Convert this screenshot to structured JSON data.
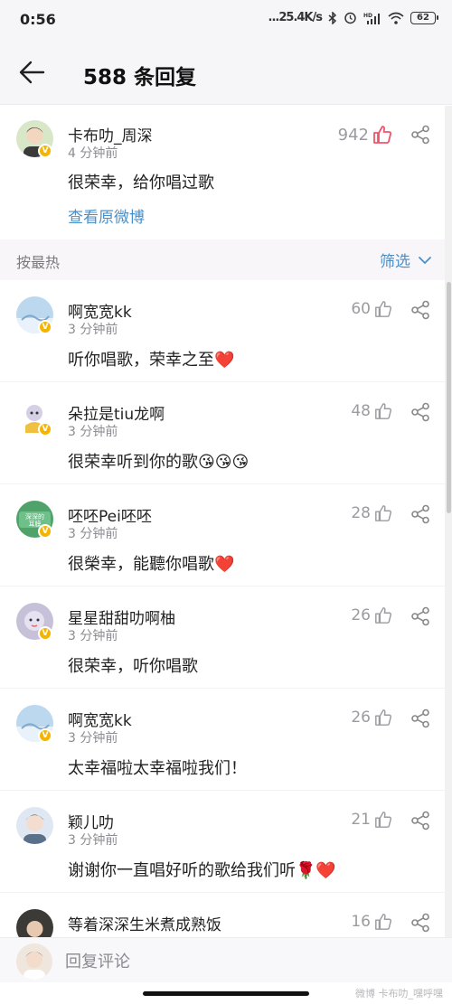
{
  "status_bar": {
    "time": "0:56",
    "network_speed": "...25.4K/s",
    "battery": "62",
    "icons": [
      "bluetooth-icon",
      "alarm-icon",
      "hd-signal-icon",
      "wifi-icon",
      "battery-icon"
    ]
  },
  "header": {
    "title": "588 条回复",
    "back_icon": "arrow-left-icon"
  },
  "original_post": {
    "author": "卡布叻_周深",
    "time": "4 分钟前",
    "text": "很荣幸，给你唱过歌",
    "likes": "942",
    "link": "查看原微博",
    "liked": true
  },
  "sort_bar": {
    "label": "按最热",
    "filter": "筛选"
  },
  "comments": [
    {
      "author": "啊宽宽kk",
      "time": "3 分钟前",
      "text": "听你唱歌，荣幸之至❤️",
      "likes": "60"
    },
    {
      "author": "朵拉是tiu龙啊",
      "time": "3 分钟前",
      "text": "很荣幸听到你的歌😘😘😘",
      "likes": "48"
    },
    {
      "author": "呸呸Pei呸呸",
      "time": "3 分钟前",
      "text": "很榮幸，能聽你唱歌❤️",
      "likes": "28"
    },
    {
      "author": "星星甜甜叻啊柚",
      "time": "3 分钟前",
      "text": "很荣幸，听你唱歌",
      "likes": "26"
    },
    {
      "author": "啊宽宽kk",
      "time": "3 分钟前",
      "text": "太幸福啦太幸福啦我们！",
      "likes": "26"
    },
    {
      "author": "颖儿叻",
      "time": "3 分钟前",
      "text": "谢谢你一直唱好听的歌给我们听🌹❤️",
      "likes": "21"
    },
    {
      "author": "等着深深生米煮成熟饭",
      "time": "",
      "text": "",
      "likes": "16"
    }
  ],
  "reply_bar": {
    "placeholder": "回复评论"
  },
  "watermark": "微博 卡布叻_嘿呼嘿",
  "colors": {
    "accent_blue": "#4a90c8",
    "like_red": "#f0556b",
    "verified_gold": "#f5b400",
    "secondary_text": "#8c8c92"
  }
}
